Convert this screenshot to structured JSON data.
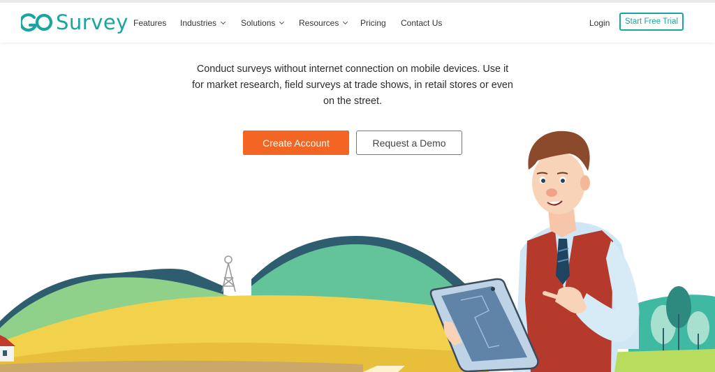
{
  "brand": {
    "logo_mark": "GO",
    "logo_text": "Survey"
  },
  "nav": {
    "items": [
      {
        "label": "Features",
        "dropdown": false
      },
      {
        "label": "Industries",
        "dropdown": true
      },
      {
        "label": "Solutions",
        "dropdown": true
      },
      {
        "label": "Resources",
        "dropdown": true
      },
      {
        "label": "Pricing",
        "dropdown": false
      },
      {
        "label": "Contact Us",
        "dropdown": false
      }
    ],
    "login_label": "Login",
    "trial_label": "Start Free Trial"
  },
  "hero": {
    "description_line1": "Conduct surveys without internet connection on mobile devices. Use it",
    "description_line2": "for market research, field surveys at trade shows, in retail stores or even",
    "description_line3": "on the street.",
    "primary_button": "Create Account",
    "secondary_button": "Request a Demo"
  },
  "colors": {
    "brand_teal": "#1aa5a0",
    "cta_orange": "#f26522",
    "hill_dark": "#2d5d6e",
    "hill_green": "#6cc59a",
    "field_yellow": "#f2d14c"
  }
}
